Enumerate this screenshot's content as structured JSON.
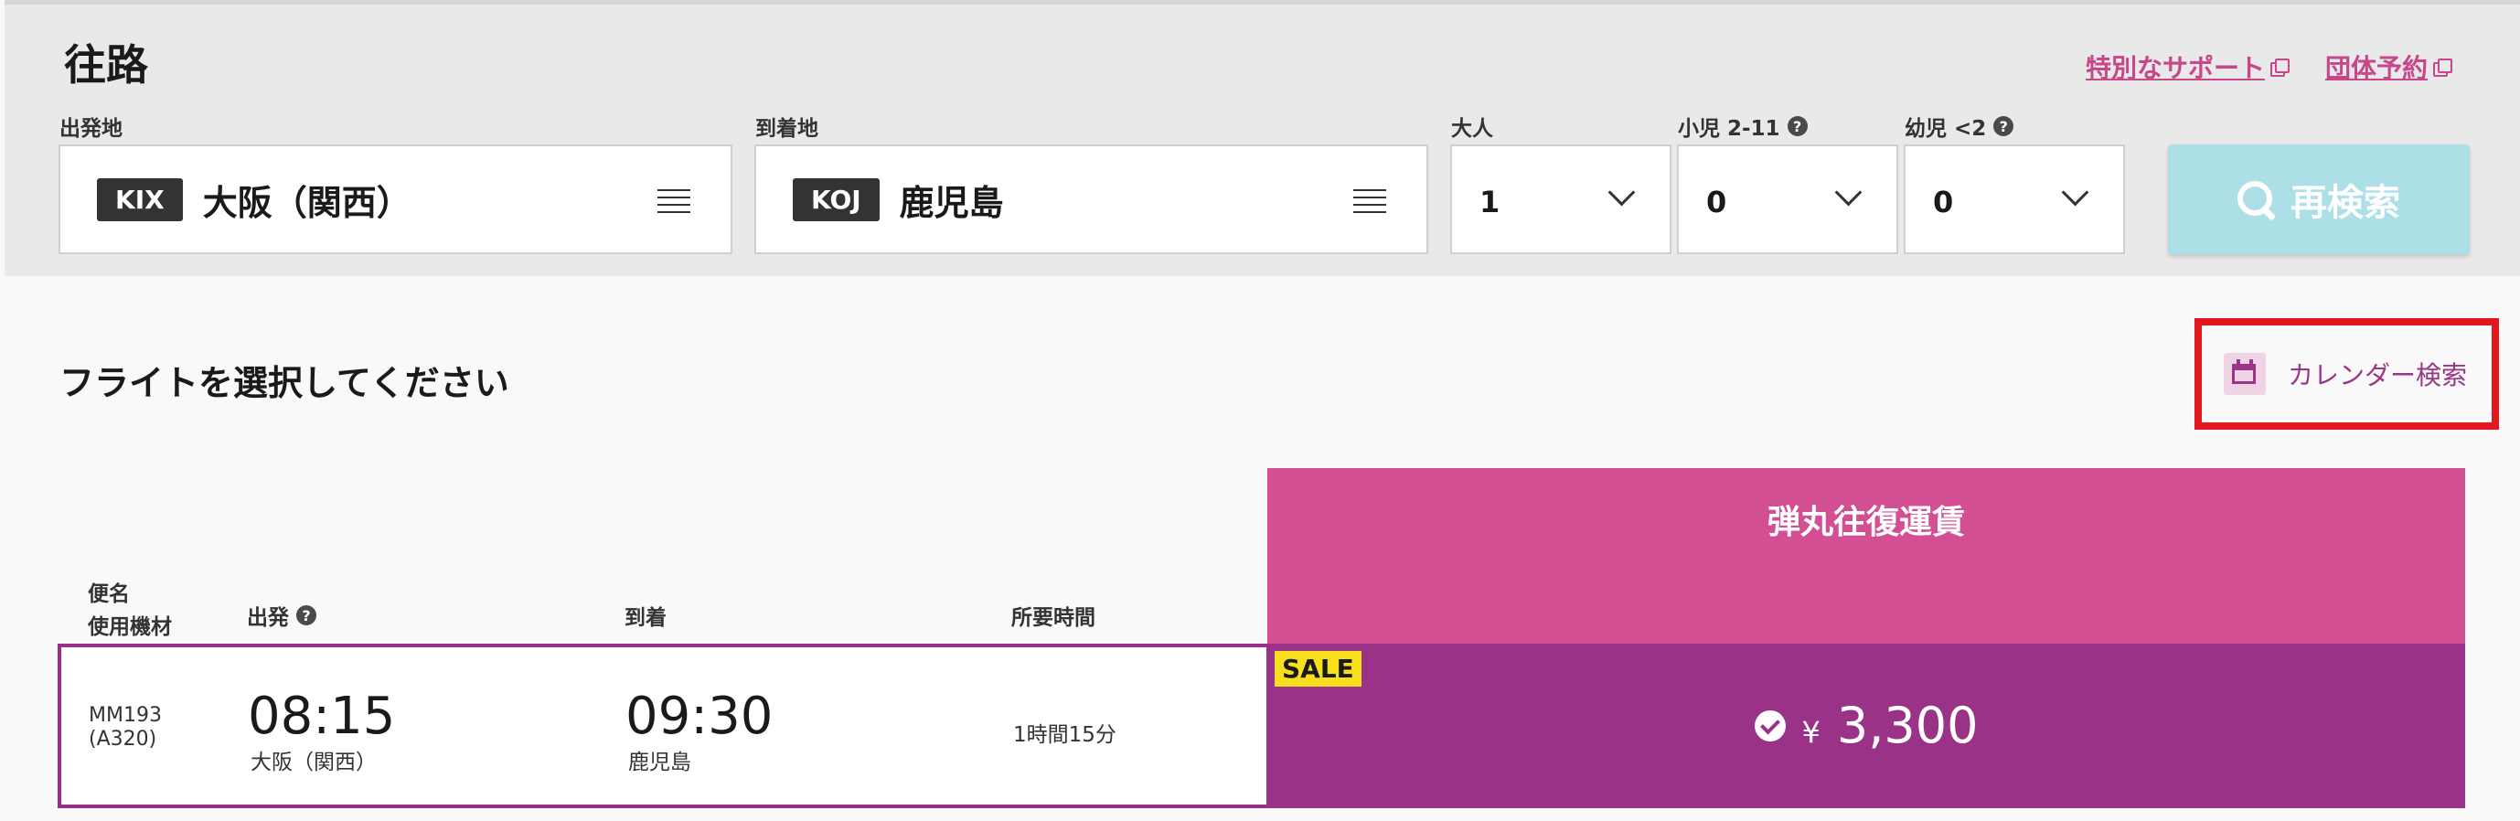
{
  "search": {
    "title": "往路",
    "links": {
      "special_support": "特別なサポート",
      "group_booking": "団体予約"
    },
    "origin": {
      "label": "出発地",
      "code": "KIX",
      "name": "大阪（関西）"
    },
    "destination": {
      "label": "到着地",
      "code": "KOJ",
      "name": "鹿児島"
    },
    "adults": {
      "label": "大人",
      "value": "1"
    },
    "children": {
      "label": "小児 2-11",
      "value": "0"
    },
    "infants": {
      "label": "幼児 <2",
      "value": "0"
    },
    "research_label": "再検索"
  },
  "results": {
    "title": "フライトを選択してください",
    "calendar_label": "カレンダー検索",
    "fare_type": "弾丸往復運賃",
    "columns": {
      "flight_line1": "便名",
      "flight_line2": "使用機材",
      "departure": "出発",
      "arrival": "到着",
      "duration": "所要時間"
    },
    "flights": [
      {
        "number": "MM193",
        "aircraft": "(A320)",
        "dep_time": "08:15",
        "dep_place": "大阪（関西）",
        "arr_time": "09:30",
        "arr_place": "鹿児島",
        "duration": "1時間15分",
        "badge": "SALE",
        "currency": "¥",
        "price": "3,300"
      }
    ]
  },
  "icons": {
    "help": "question-circle-icon",
    "list": "list-icon",
    "dropdown": "chevron-down-icon",
    "search": "search-icon",
    "calendar": "calendar-icon",
    "check": "check-circle-icon",
    "external": "external-link-icon"
  },
  "colors": {
    "panel_bg": "#e9e9e9",
    "accent_pink": "#c8468a",
    "fare_header": "#d24f94",
    "fare_cell": "#9a3388",
    "research_button": "#acdfe6",
    "sale_badge": "#f7df1e",
    "highlight_box": "#e1191e"
  }
}
